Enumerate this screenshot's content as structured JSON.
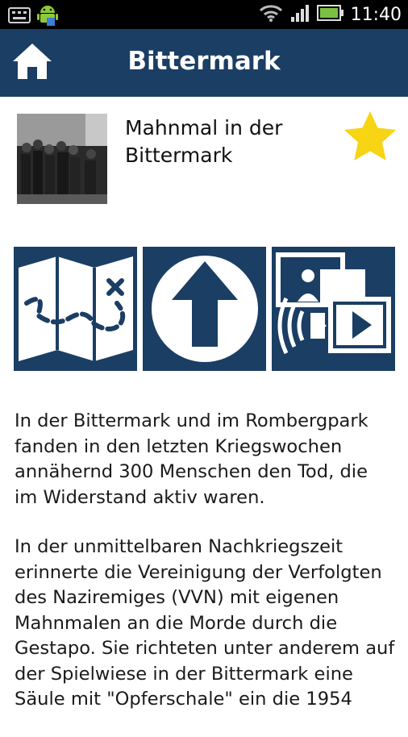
{
  "status_bar": {
    "time": "11:40",
    "icons": [
      "keyboard-icon",
      "android-icon",
      "wifi-icon",
      "signal-icon",
      "battery-icon"
    ]
  },
  "app_bar": {
    "title": "Bittermark",
    "home_icon": "home-icon"
  },
  "place": {
    "name": "Mahnmal in der Bittermark",
    "favorite_icon": "star-icon"
  },
  "actions": [
    {
      "name": "map-button",
      "icon": "map-icon"
    },
    {
      "name": "navigate-button",
      "icon": "arrow-up-icon"
    },
    {
      "name": "media-button",
      "icon": "media-icon"
    }
  ],
  "description": {
    "paragraphs": [
      "In der Bittermark und im Rombergpark fanden in den letzten Kriegswochen annähernd 300 Menschen den Tod, die im Widerstand aktiv waren.",
      "In der unmittelbaren Nachkriegszeit erinnerte die Vereinigung der Verfolgten des Naziremiges (VVN) mit eigenen Mahnmalen an die Morde durch die Gestapo. Sie richteten unter anderem auf der Spielwiese in der Bittermark eine Säule mit \"Opferschale\" ein die 1954"
    ]
  },
  "colors": {
    "app_bar": "#1b3e64",
    "star": "#f7d414",
    "text": "#1a1a1a"
  }
}
